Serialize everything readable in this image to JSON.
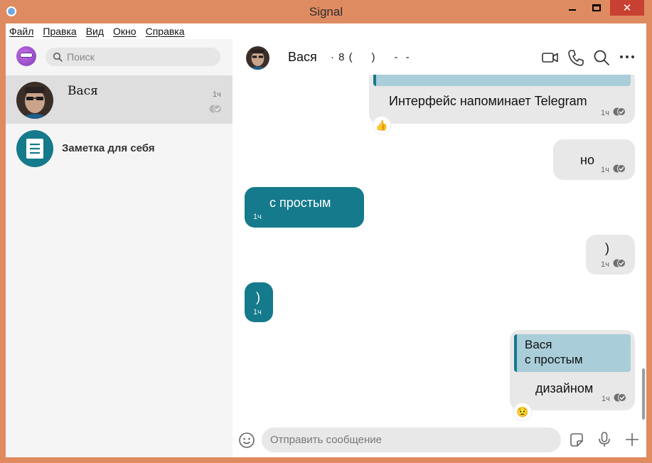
{
  "window": {
    "title": "Signal",
    "close_glyph": "✕"
  },
  "menu": [
    "Файл",
    "Правка",
    "Вид",
    "Окно",
    "Справка"
  ],
  "search": {
    "placeholder": "Поиск"
  },
  "conversations": [
    {
      "name": "Вася",
      "time": "1ч",
      "status": "read-check-icon",
      "active": true
    },
    {
      "name": "Заметка для себя",
      "icon": "note-icon"
    }
  ],
  "chat": {
    "name": "Вася",
    "subtitle": "· 8 (     )     -  -",
    "icons": [
      "video-call-icon",
      "phone-call-icon",
      "search-icon",
      "more-icon"
    ]
  },
  "messages": [
    {
      "direction": "out",
      "text": "Интерфейс напоминает Telegram",
      "time": "1ч",
      "reaction": "👍"
    },
    {
      "direction": "out",
      "text": "но",
      "time": "1ч"
    },
    {
      "direction": "in",
      "text": "с простым",
      "time": "1ч"
    },
    {
      "direction": "out",
      "text": ")",
      "time": "1ч"
    },
    {
      "direction": "in",
      "text": ")",
      "time": "1ч"
    },
    {
      "direction": "out",
      "quote_author": "Вася",
      "quote_text": "с простым",
      "text": "дизайном",
      "time": "1ч",
      "reaction": "😟"
    }
  ],
  "composer": {
    "placeholder": "Отправить сообщение",
    "icons": [
      "emoji-icon",
      "sticker-icon",
      "microphone-icon",
      "plus-icon"
    ]
  },
  "colors": {
    "accent": "#157a8b",
    "outgoing_bubble": "#e8e8e8",
    "quote_bg": "#a9cdd9",
    "titlebar": "#df8b61"
  }
}
